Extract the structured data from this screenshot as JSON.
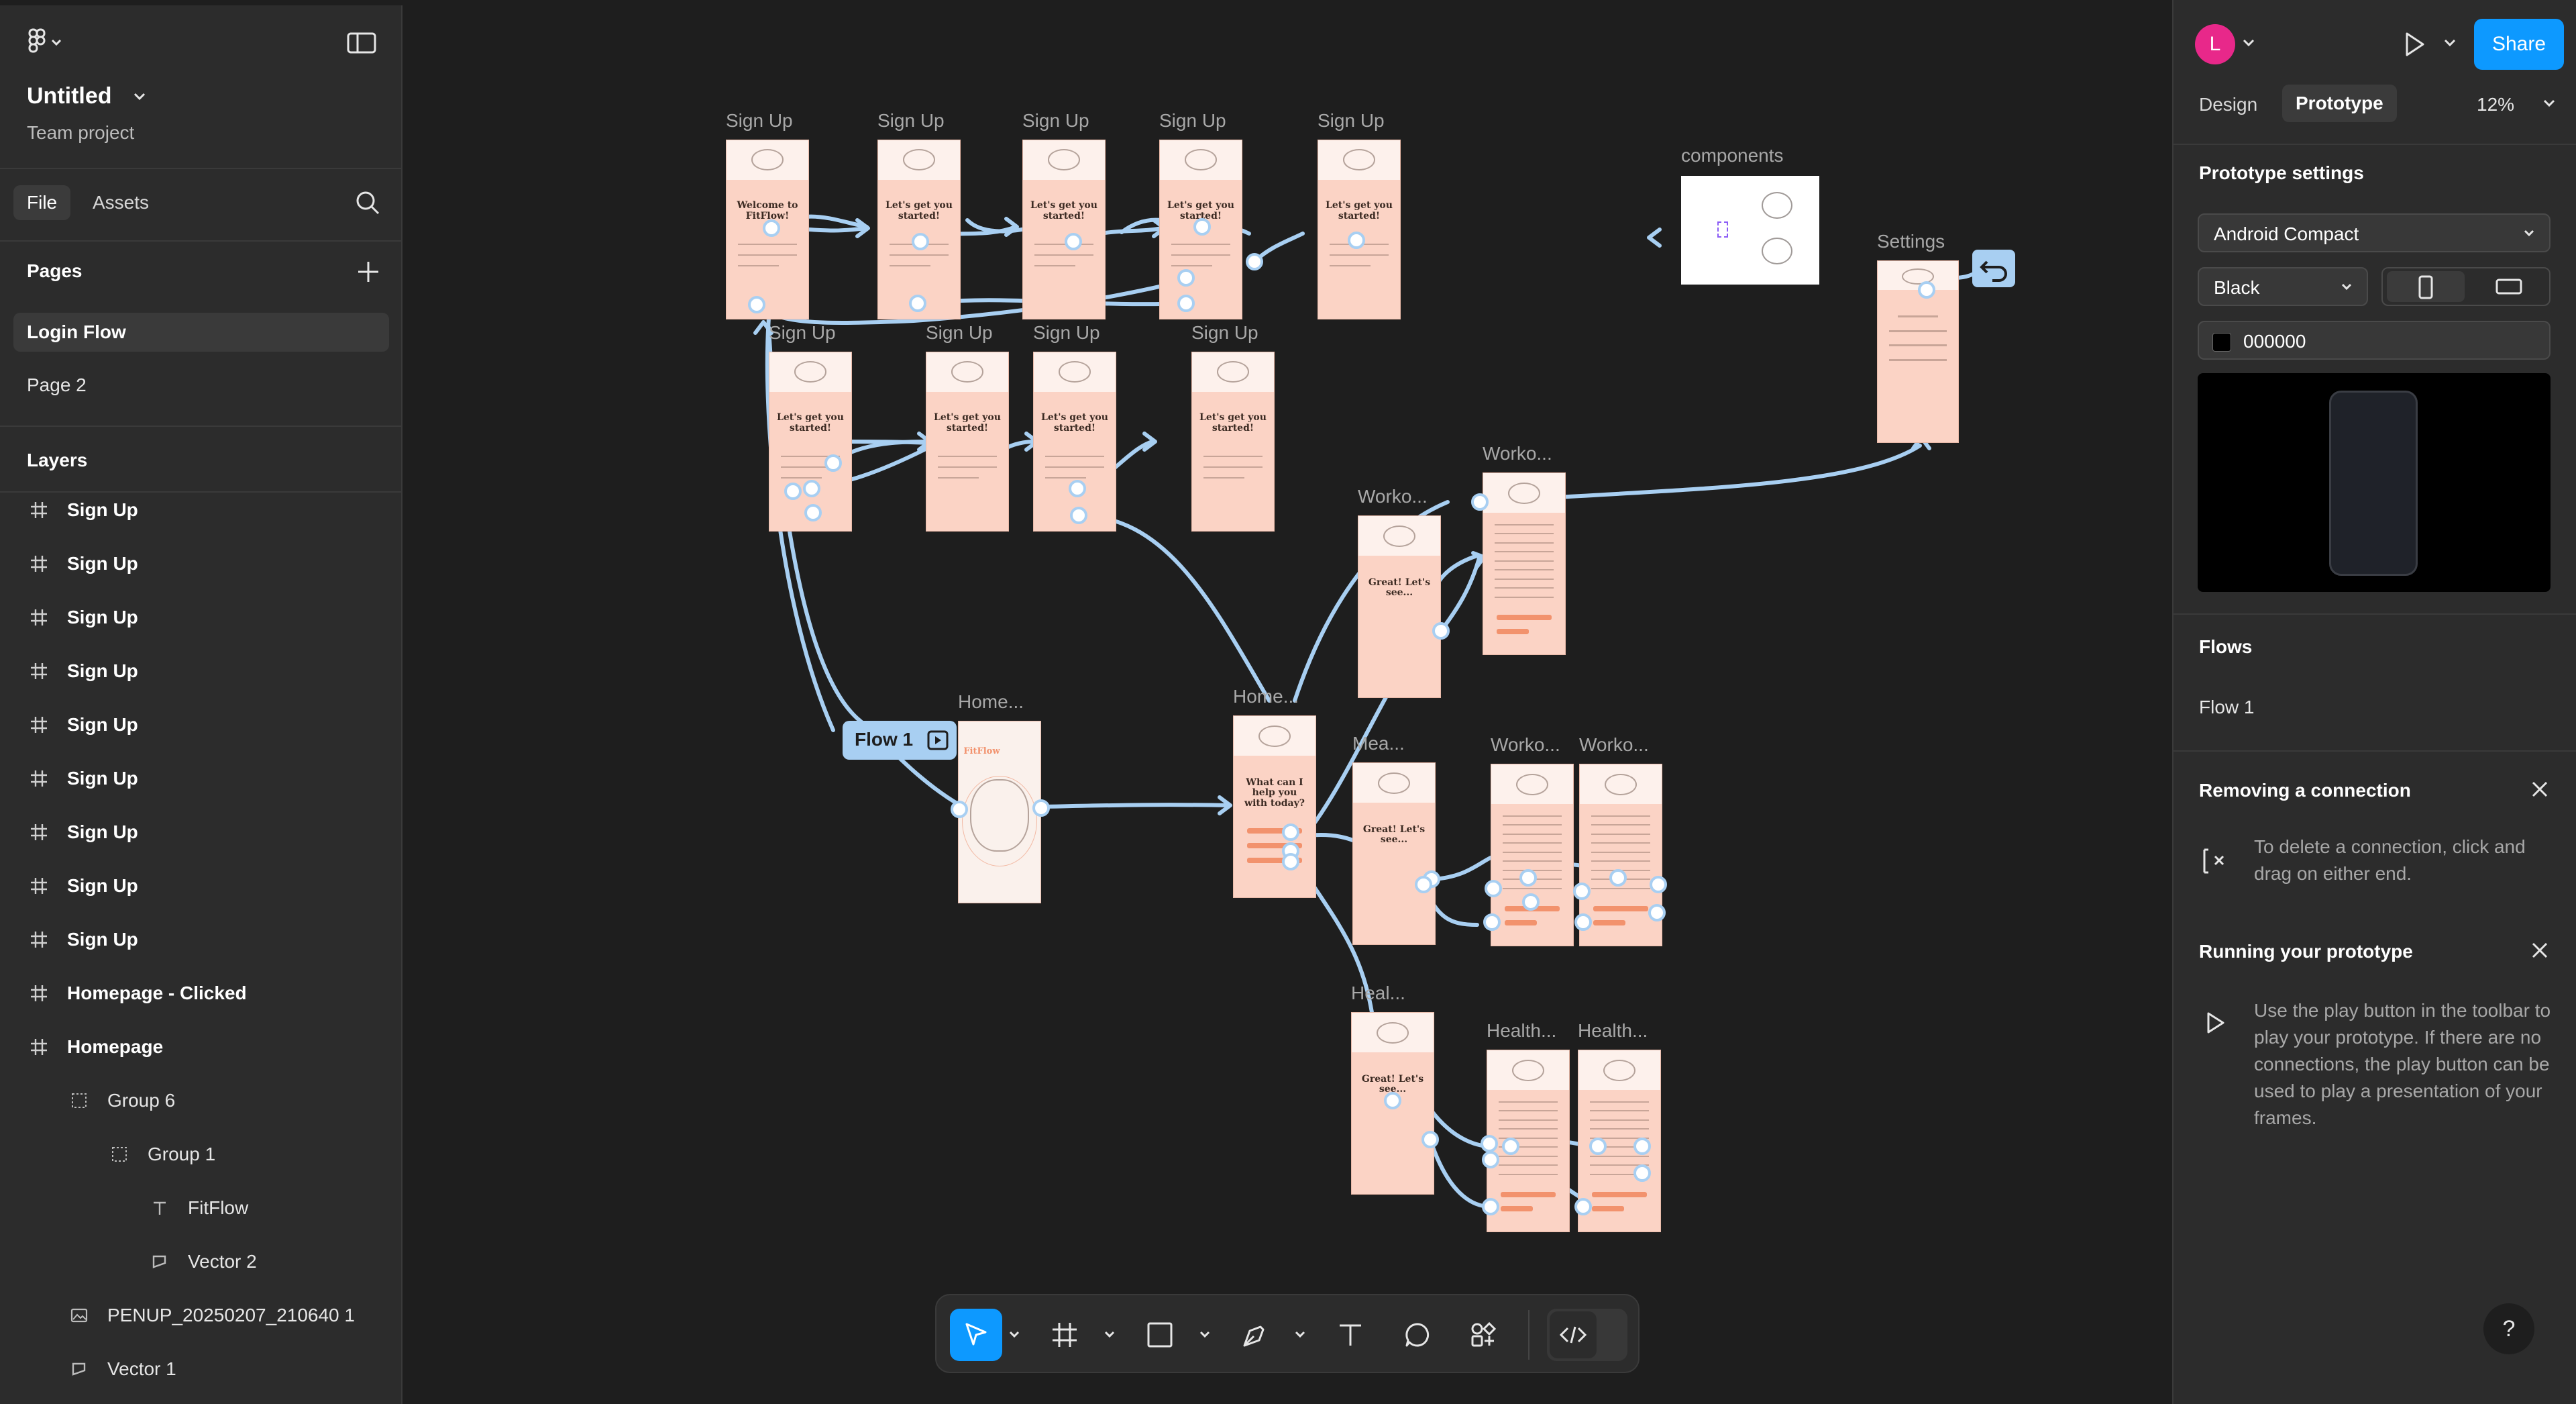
{
  "app": {
    "doc_title": "Untitled",
    "project": "Team project",
    "avatar_letter": "L",
    "share_label": "Share",
    "zoom": "12%"
  },
  "left_panel": {
    "tabs": [
      "File",
      "Assets"
    ],
    "pages_heading": "Pages",
    "pages": [
      "Login Flow",
      "Page 2"
    ],
    "layers_heading": "Layers",
    "layers": [
      {
        "name": "Sign Up",
        "type": "frame",
        "indent": 0
      },
      {
        "name": "Sign Up",
        "type": "frame",
        "indent": 0
      },
      {
        "name": "Sign Up",
        "type": "frame",
        "indent": 0
      },
      {
        "name": "Sign Up",
        "type": "frame",
        "indent": 0
      },
      {
        "name": "Sign Up",
        "type": "frame",
        "indent": 0
      },
      {
        "name": "Sign Up",
        "type": "frame",
        "indent": 0
      },
      {
        "name": "Sign Up",
        "type": "frame",
        "indent": 0
      },
      {
        "name": "Sign Up",
        "type": "frame",
        "indent": 0
      },
      {
        "name": "Sign Up",
        "type": "frame",
        "indent": 0
      },
      {
        "name": "Homepage - Clicked",
        "type": "frame",
        "indent": 0
      },
      {
        "name": "Homepage",
        "type": "frame",
        "indent": 0
      },
      {
        "name": "Group 6",
        "type": "group",
        "indent": 1
      },
      {
        "name": "Group 1",
        "type": "group",
        "indent": 2
      },
      {
        "name": "FitFlow",
        "type": "text",
        "indent": 3
      },
      {
        "name": "Vector 2",
        "type": "vector",
        "indent": 3
      },
      {
        "name": "PENUP_20250207_210640 1",
        "type": "image",
        "indent": 1
      },
      {
        "name": "Vector 1",
        "type": "vector",
        "indent": 1
      }
    ]
  },
  "canvas": {
    "flow_badge": "Flow 1",
    "frames": [
      {
        "label": "Sign Up",
        "title": "Welcome to FitFlow!"
      },
      {
        "label": "Sign Up",
        "title": "Let's get you started!"
      },
      {
        "label": "Sign Up",
        "title": "Let's get you started!"
      },
      {
        "label": "Sign Up",
        "title": "Let's get you started!"
      },
      {
        "label": "Sign Up",
        "title": "Let's get you started!"
      },
      {
        "label": "Sign Up",
        "title": "Let's get you started!"
      },
      {
        "label": "Sign Up",
        "title": "Let's get you started!"
      },
      {
        "label": "Sign Up",
        "title": "Let's get you started!"
      },
      {
        "label": "Sign Up",
        "title": "Let's get you started!"
      },
      {
        "label": "components",
        "title": ""
      },
      {
        "label": "Settings",
        "title": ""
      },
      {
        "label": "Home...",
        "title": "FitFlow"
      },
      {
        "label": "Home...",
        "title": "What can I help you with today?"
      },
      {
        "label": "Worko...",
        "title": "Great! Let's see..."
      },
      {
        "label": "Worko...",
        "title": ""
      },
      {
        "label": "Mea...",
        "title": "Great! Let's see..."
      },
      {
        "label": "Worko...",
        "title": ""
      },
      {
        "label": "Worko...",
        "title": ""
      },
      {
        "label": "Heal...",
        "title": "Great! Let's see..."
      },
      {
        "label": "Health...",
        "title": ""
      },
      {
        "label": "Health...",
        "title": ""
      }
    ]
  },
  "right_panel": {
    "tabs": [
      "Design",
      "Prototype"
    ],
    "prototype_settings_heading": "Prototype settings",
    "device": "Android Compact",
    "device_color": "Black",
    "background_hex": "000000",
    "flows_heading": "Flows",
    "flows": [
      "Flow 1"
    ],
    "tip_remove": {
      "title": "Removing a connection",
      "body": "To delete a connection, click and drag on either end."
    },
    "tip_run": {
      "title": "Running your prototype",
      "body": "Use the play button in the toolbar to play your prototype. If there are no connections, the play button can be used to play a presentation of your frames."
    },
    "help": "?"
  },
  "toolbar": {
    "tools": [
      "move-tool",
      "frame-tool",
      "shape-tool",
      "pen-tool",
      "text-tool",
      "comment-tool",
      "actions-tool",
      "dev-mode-toggle"
    ],
    "active": "move-tool"
  },
  "colors": {
    "accent": "#0d99ff",
    "connection": "#a8cff2",
    "frame_fill": "#fbd3c5",
    "avatar": "#e8288a"
  }
}
